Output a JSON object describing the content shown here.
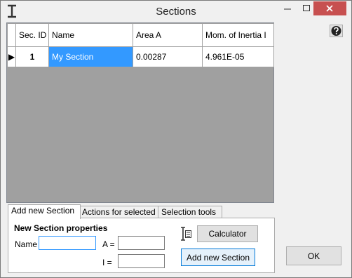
{
  "window": {
    "title": "Sections"
  },
  "grid": {
    "columns": [
      "Sec. ID",
      "Name",
      "Area A",
      "Mom. of Inertia I"
    ],
    "rows": [
      {
        "marker": "▶",
        "id": "1",
        "name": "My Section",
        "area": "0.00287",
        "inertia": "4.961E-05"
      }
    ]
  },
  "tabs": [
    "Add new Section",
    "Actions for selected",
    "Selection tools"
  ],
  "panel": {
    "title": "New Section properties",
    "name_label": "Name",
    "name_value": "",
    "area_label": "A =",
    "area_value": "",
    "inertia_label": "I =",
    "inertia_value": "",
    "calculator_label": "Calculator",
    "add_label": "Add new Section"
  },
  "ok_label": "OK",
  "colors": {
    "selection": "#3399ff",
    "grid_background": "#a0a0a0",
    "close_button": "#c75050"
  },
  "icons": [
    "app-icon",
    "minimize-icon",
    "maximize-icon",
    "close-icon",
    "help-icon",
    "calculator-icon",
    "row-pointer-icon"
  ]
}
